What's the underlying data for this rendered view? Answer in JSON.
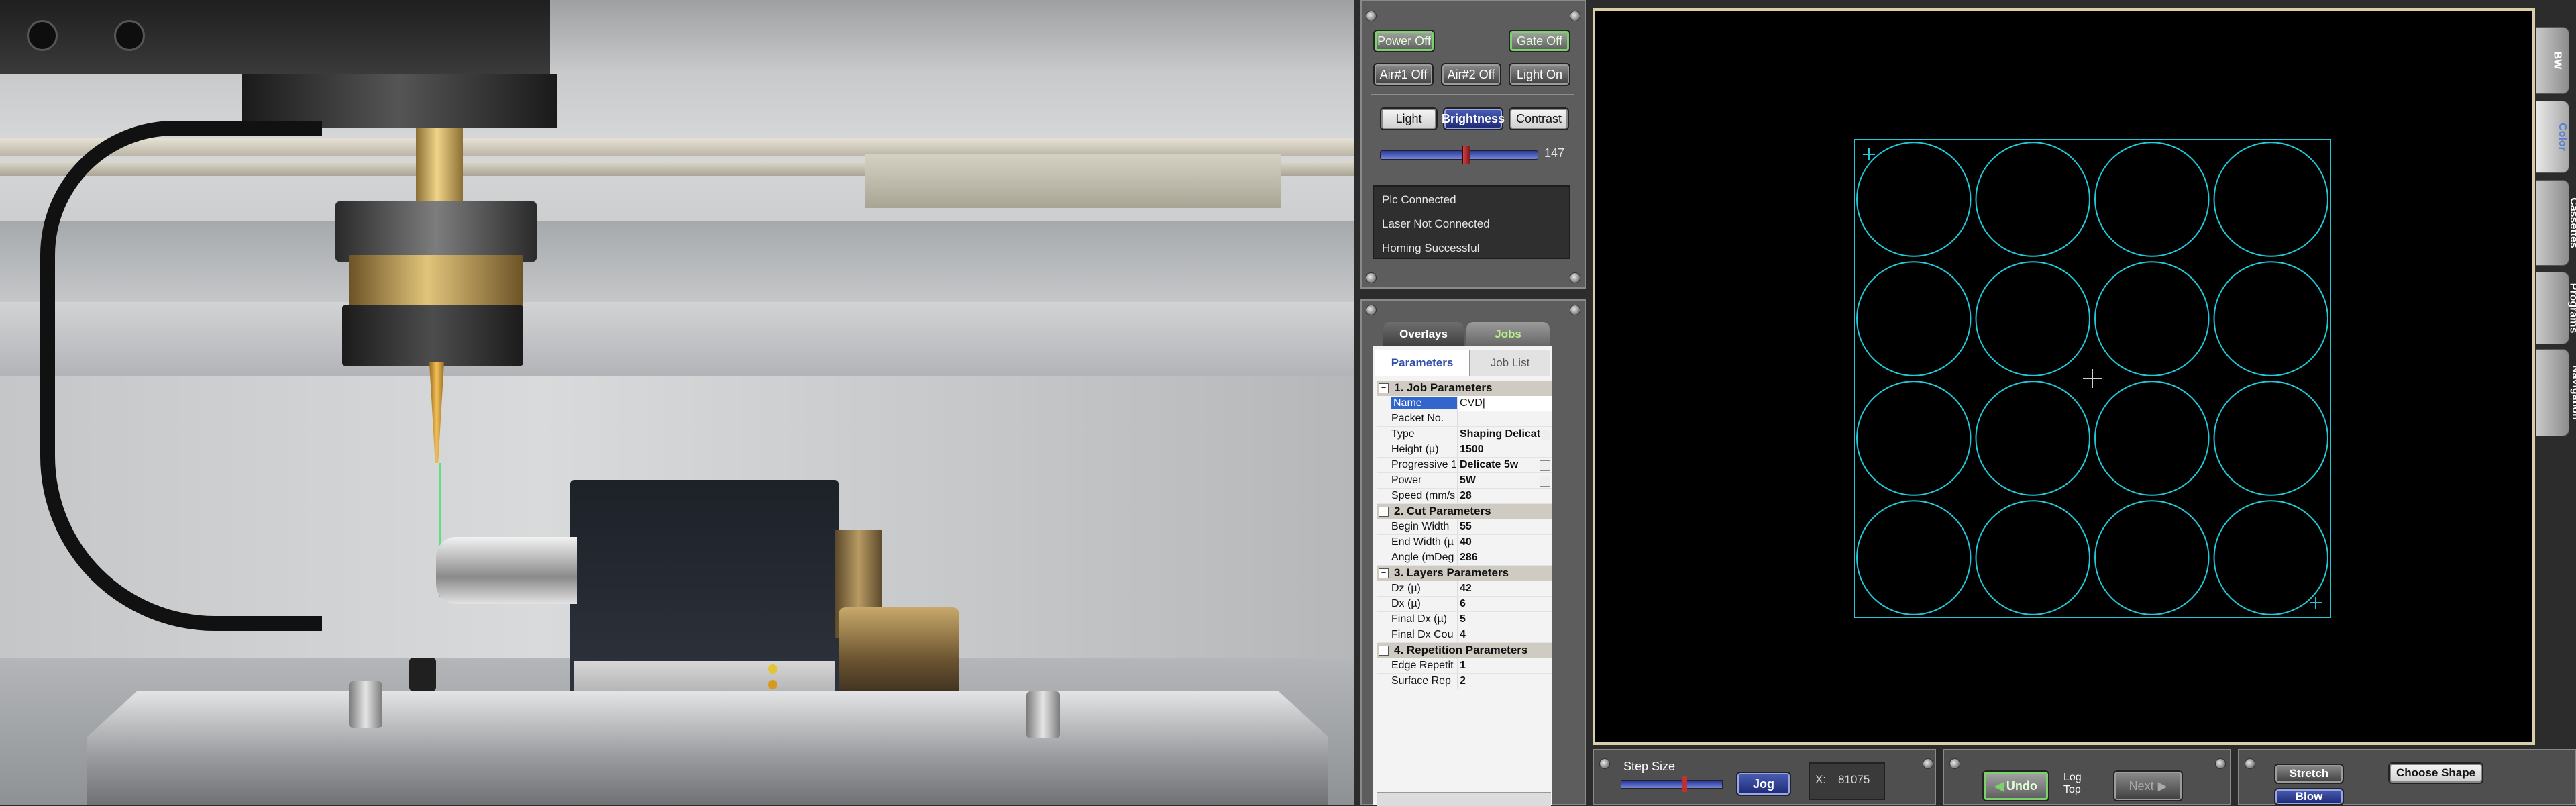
{
  "camera": {
    "description_icon": "camera-feed"
  },
  "power_panel": {
    "power_off": "Power Off",
    "gate_off": "Gate Off",
    "air1_off": "Air#1 Off",
    "air2_off": "Air#2 Off",
    "light_on": "Light On",
    "light": "Light",
    "brightness": "Brightness",
    "contrast": "Contrast",
    "slider_value": "147",
    "slider_level": 0.54,
    "status": [
      "Plc Connected",
      "Laser Not Connected",
      "Homing Successful"
    ]
  },
  "job_panel": {
    "tab_overlays": "Overlays",
    "tab_jobs": "Jobs",
    "subtab_parameters": "Parameters",
    "subtab_job_list": "Job List",
    "sections": [
      {
        "title": "1. Job Parameters",
        "rows": [
          {
            "key": "Name",
            "value": "CVD|"
          },
          {
            "key": "Packet No.",
            "value": ""
          },
          {
            "key": "Type",
            "value": "Shaping Delicate"
          },
          {
            "key": "Height (µ)",
            "value": "1500"
          },
          {
            "key": "Progressive 1",
            "value": "Delicate 5w"
          },
          {
            "key": "Power",
            "value": "5W"
          },
          {
            "key": "Speed (mm/s",
            "value": "28"
          }
        ]
      },
      {
        "title": "2. Cut Parameters",
        "rows": [
          {
            "key": "Begin Width",
            "value": "55"
          },
          {
            "key": "End Width (µ",
            "value": "40"
          },
          {
            "key": "Angle (mDeg",
            "value": "286"
          }
        ]
      },
      {
        "title": "3. Layers Parameters",
        "rows": [
          {
            "key": "Dz (µ)",
            "value": "42"
          },
          {
            "key": "Dx (µ)",
            "value": "6"
          },
          {
            "key": "Final Dx (µ)",
            "value": "5"
          },
          {
            "key": "Final Dx Cou",
            "value": "4"
          }
        ]
      },
      {
        "title": "4. Repetition Parameters",
        "rows": [
          {
            "key": "Edge Repetit",
            "value": "1"
          },
          {
            "key": "Surface Rep",
            "value": "2"
          }
        ]
      }
    ]
  },
  "canvas": {
    "grid_rows": 4,
    "grid_cols": 4,
    "stroke_color": "#22c8d8",
    "background": "#000000"
  },
  "right_tabs": [
    "BW",
    "Color",
    "Cassettes",
    "Programs",
    "Navigation"
  ],
  "bottom": {
    "step_size": "Step Size",
    "jog": "Jog",
    "x_label": "X:",
    "x_value": "81075",
    "undo": "Undo",
    "log_top": "Log\nTop",
    "next": "Next",
    "stretch": "Stretch",
    "choose_shape": "Choose Shape",
    "blow": "Blow"
  },
  "colors": {
    "accent_green": "#7bd26b",
    "accent_blue": "#2a3aa0",
    "cyan": "#22c8d8"
  }
}
